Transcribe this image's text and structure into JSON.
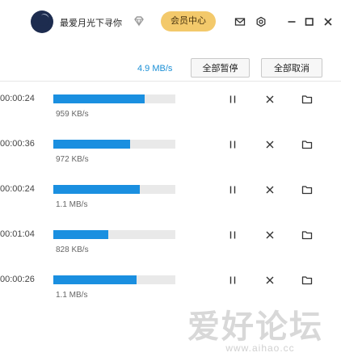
{
  "header": {
    "username": "最爱月光下寻你",
    "vip_label": "会员中心",
    "icons": [
      "diamond-icon",
      "mail-icon",
      "settings-icon",
      "minimize-icon",
      "maximize-icon",
      "close-icon"
    ]
  },
  "toolbar": {
    "total_speed": "4.9 MB/s",
    "pause_all_label": "全部暂停",
    "cancel_all_label": "全部取消"
  },
  "downloads": [
    {
      "time_left": "00:00:24",
      "speed": "959 KB/s",
      "progress": 0.75
    },
    {
      "time_left": "00:00:36",
      "speed": "972 KB/s",
      "progress": 0.63
    },
    {
      "time_left": "00:00:24",
      "speed": "1.1 MB/s",
      "progress": 0.71
    },
    {
      "time_left": "00:01:04",
      "speed": "828 KB/s",
      "progress": 0.45
    },
    {
      "time_left": "00:00:26",
      "speed": "1.1 MB/s",
      "progress": 0.68
    }
  ],
  "watermark": {
    "text": "爱好论坛",
    "url": "www.aihao.cc"
  },
  "colors": {
    "accent": "#1a8fe0",
    "vip": "#f3c96b",
    "track": "#e9e9e9"
  }
}
